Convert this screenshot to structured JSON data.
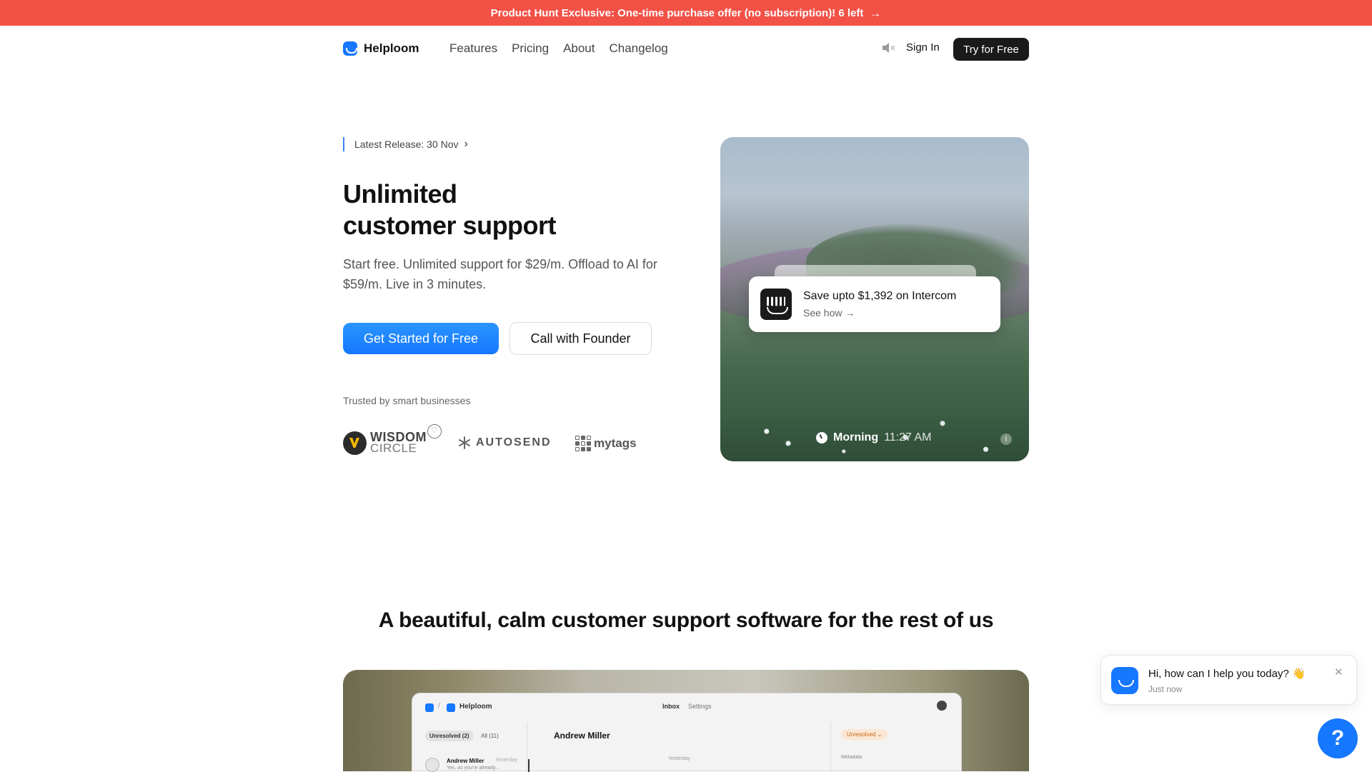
{
  "banner": {
    "text": "Product Hunt Exclusive: One-time purchase offer (no subscription)! 6 left",
    "arrow": "→",
    "color": "#f25146"
  },
  "nav": {
    "brand": "Helploom",
    "links": [
      "Features",
      "Pricing",
      "About",
      "Changelog"
    ],
    "mute_icon": "speaker-muted-icon",
    "sign_in": "Sign In",
    "cta": "Try for Free"
  },
  "hero": {
    "release": "Latest Release: 30 Nov",
    "release_chevron": "›",
    "title_line1": "Unlimited",
    "title_line2": "customer support",
    "subtitle": "Start free. Unlimited support for $29/m. Offload to AI for $59/m. Live in 3 minutes.",
    "primary_button": "Get Started for Free",
    "secondary_button": "Call with Founder",
    "trusted_label": "Trusted by smart businesses",
    "logos": {
      "wisdom_line1": "WISDOM",
      "wisdom_line2": "CIRCLE",
      "autosend": "AUTOSEND",
      "mytags": "mytags"
    }
  },
  "scene": {
    "promo_title": "Save upto $1,392 on Intercom",
    "promo_link": "See how →",
    "caption_label": "Morning",
    "caption_time": "11:27 AM",
    "info_glyph": "i"
  },
  "section2": {
    "tagline": "A beautiful, calm customer support software for the rest of us"
  },
  "app_preview": {
    "app_name": "Helploom",
    "slash": "/",
    "nav_inbox": "Inbox",
    "nav_settings": "Settings",
    "tab_unresolved": "Unresolved (2)",
    "tab_all": "All (11)",
    "conversation_name": "Andrew Miller",
    "day_label": "Yesterday",
    "status": "Unresolved ⌄",
    "metadata_label": "Metadata",
    "row_name": "Andrew Miller",
    "row_time": "Yesterday",
    "row_snippet": "Yes, as you're already..."
  },
  "chat": {
    "message": "Hi, how can I help you today? 👋",
    "time": "Just now",
    "close": "✕",
    "help": "?"
  },
  "colors": {
    "accent": "#1677ff",
    "banner": "#f25146",
    "dark_button": "#1a1a1a"
  }
}
